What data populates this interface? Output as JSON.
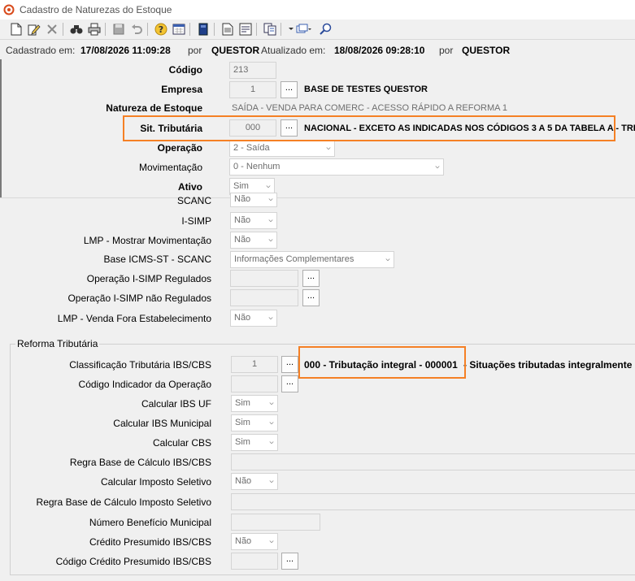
{
  "window": {
    "title": "Cadastro de Naturezas do Estoque"
  },
  "toolbar": {
    "icons": [
      "new-document-icon",
      "edit-document-icon",
      "delete-icon",
      "find-icon",
      "print-icon",
      "save-icon",
      "undo-icon",
      "help-icon",
      "calendar-icon",
      "book-icon",
      "report-icon",
      "report-view-icon",
      "copy-icon",
      "dropdown-icon",
      "window-menu-icon",
      "search-icon"
    ]
  },
  "info": {
    "cadastrado_label": "Cadastrado em:",
    "cadastrado_value": "17/08/2026 11:09:28",
    "por1_label": "por",
    "por1_value": "QUESTOR",
    "atualizado_label": "Atualizado em:",
    "atualizado_value": "18/08/2026 09:28:10",
    "por2_label": "por",
    "por2_value": "QUESTOR"
  },
  "top": {
    "codigo_label": "Código",
    "codigo_value": "213",
    "empresa_label": "Empresa",
    "empresa_value": "1",
    "empresa_desc": "BASE DE TESTES QUESTOR",
    "natureza_label": "Natureza de Estoque",
    "natureza_value": "SAÍDA - VENDA PARA COMERC - ACESSO RÁPIDO A REFORMA 1",
    "sit_label": "Sit. Tributária",
    "sit_value": "000",
    "sit_desc": "NACIONAL - EXCETO AS INDICADAS NOS CÓDIGOS 3 A 5 DA TABELA A - TRI",
    "operacao_label": "Operação",
    "operacao_value": "2 - Saída",
    "movimentacao_label": "Movimentação",
    "movimentacao_value": "0 - Nenhum",
    "ativo_label": "Ativo",
    "ativo_value": "Sim",
    "button_ellipsis": "..."
  },
  "middle": {
    "scanc_label": "SCANC",
    "scanc_value": "Não",
    "isimp_label": "I-SIMP",
    "isimp_value": "Não",
    "lmp_label": "LMP - Mostrar Movimentação",
    "lmp_value": "Não",
    "base_icms_label": "Base ICMS-ST - SCANC",
    "base_icms_value": "Informações Complementares",
    "op_isimp_reg_label": "Operação I-SIMP Regulados",
    "op_isimp_nreg_label": "Operação I-SIMP não Regulados",
    "lmp_venda_label": "LMP - Venda Fora Estabelecimento",
    "lmp_venda_value": "Não"
  },
  "reforma": {
    "group_title": "Reforma Tributária",
    "class_label": "Classificação Tributária IBS/CBS",
    "class_value": "1",
    "class_desc_bold": "000 - Tributação integral - 000001",
    "class_desc_rest": " - Situações tributadas integralmente",
    "cod_ind_label": "Código Indicador da Operação",
    "ibs_uf_label": "Calcular IBS UF",
    "ibs_uf_value": "Sim",
    "ibs_mun_label": "Calcular IBS Municipal",
    "ibs_mun_value": "Sim",
    "cbs_label": "Calcular CBS",
    "cbs_value": "Sim",
    "regra_base_label": "Regra Base de Cálculo IBS/CBS",
    "imp_sel_label": "Calcular Imposto Seletivo",
    "imp_sel_value": "Não",
    "regra_imp_sel_label": "Regra Base de Cálculo Imposto Seletivo",
    "num_benef_label": "Número Benefício Municipal",
    "cred_pres_label": "Crédito Presumido IBS/CBS",
    "cred_pres_value": "Não",
    "cod_cred_label": "Código Crédito Presumido IBS/CBS"
  },
  "colors": {
    "highlight": "#f58025"
  }
}
